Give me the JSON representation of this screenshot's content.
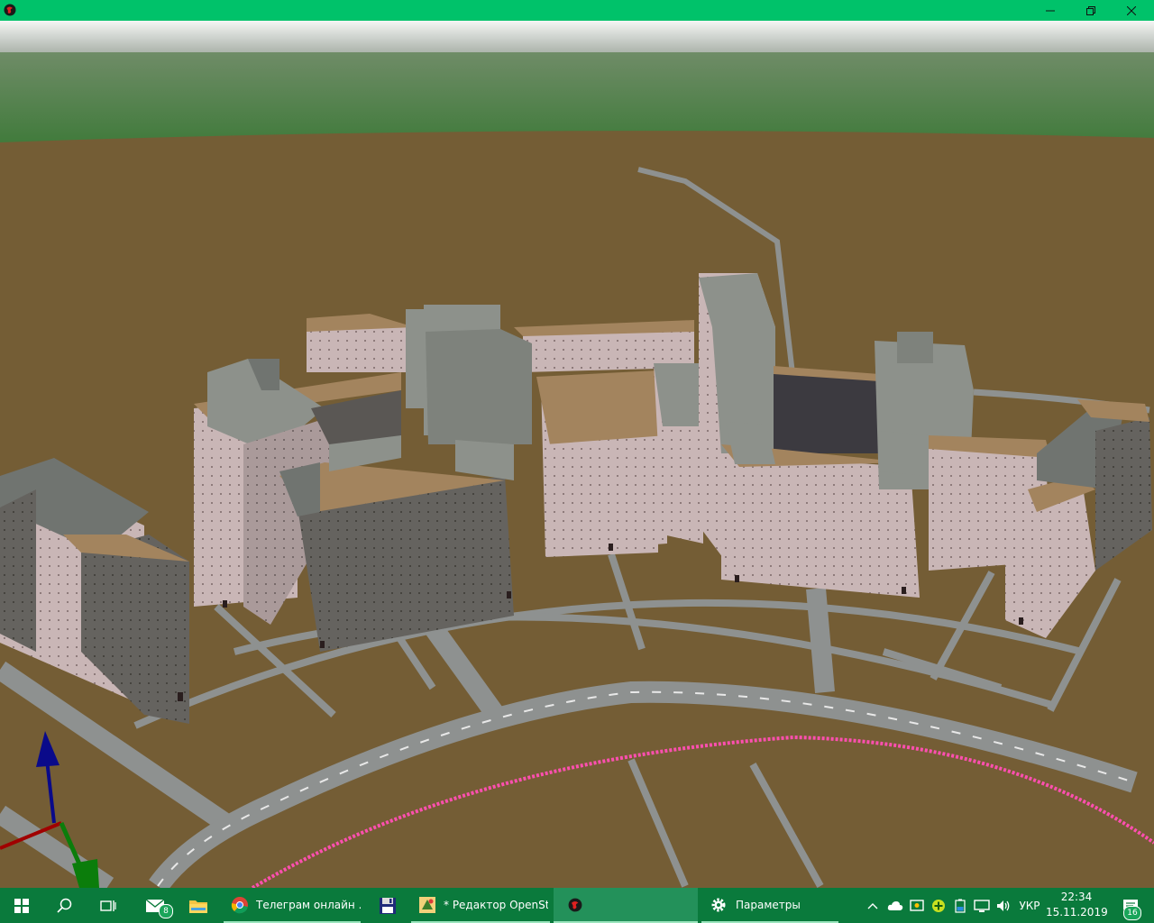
{
  "window": {
    "icons": {
      "app": "app-logo-icon",
      "minimize": "minimize-icon",
      "maximize": "maximize-icon",
      "close": "close-icon"
    }
  },
  "scene": {
    "colors": {
      "sky": "#9aa39a",
      "forest": "#4b7a45",
      "ground": "#745d35",
      "road": "#8e9190",
      "road_dash": "#e8e8e8",
      "building_light": "#c9b6b6",
      "building_dark": "#65635f",
      "building_gray": "#8d918b",
      "roof": "#a3845e",
      "path_highlight": "#ff4fb0",
      "axis_x": "#a00000",
      "axis_y": "#0b7d0b",
      "axis_z": "#0a0a8a"
    }
  },
  "taskbar": {
    "items": [
      {
        "name": "start",
        "icon": "windows-start-icon"
      },
      {
        "name": "search",
        "icon": "search-icon"
      },
      {
        "name": "task-view",
        "icon": "task-view-icon"
      },
      {
        "name": "mail",
        "icon": "mail-icon",
        "badge": "8"
      },
      {
        "name": "explorer",
        "icon": "folder-icon"
      },
      {
        "name": "chrome",
        "icon": "chrome-icon",
        "label": "Телеграм онлайн ..."
      },
      {
        "name": "save-app",
        "icon": "floppy-disk-icon"
      },
      {
        "name": "josm",
        "icon": "josm-icon",
        "label": "* Редактор OpenSt..."
      },
      {
        "name": "viewer",
        "icon": "app-logo-icon"
      },
      {
        "name": "settings",
        "icon": "gear-icon",
        "label": "Параметры"
      }
    ],
    "tray": {
      "language": "УКР",
      "time": "22:34",
      "date": "15.11.2019",
      "notifications": "16"
    }
  }
}
